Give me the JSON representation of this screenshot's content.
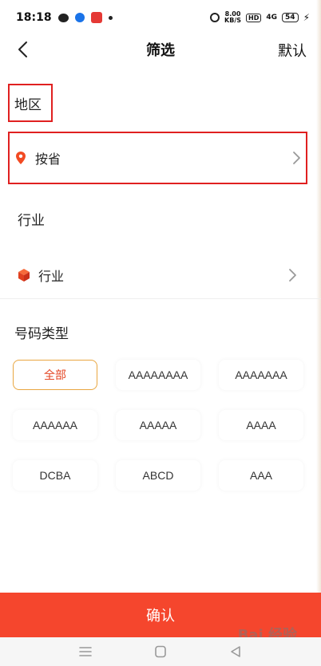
{
  "status_bar": {
    "time": "18:18",
    "net_speed_value": "8.00",
    "net_speed_unit": "KB/S",
    "hd_label": "HD",
    "signal_label": "4G",
    "battery": "54"
  },
  "header": {
    "title": "筛选",
    "right_action": "默认"
  },
  "region": {
    "heading": "地区",
    "row_label": "按省"
  },
  "industry": {
    "heading": "行业",
    "row_label": "行业"
  },
  "number_type": {
    "heading": "号码类型",
    "options": [
      "全部",
      "AAAAAAAA",
      "AAAAAAA",
      "AAAAAA",
      "AAAAA",
      "AAAA",
      "DCBA",
      "ABCD",
      "AAA"
    ],
    "selected_index": 0
  },
  "footer": {
    "confirm_label": "确认"
  },
  "watermark": "Bai 经验",
  "colors": {
    "accent": "#f5462d",
    "highlight_border": "#e02020",
    "selected_chip_border": "#e9a640",
    "selected_chip_text": "#e44523"
  }
}
